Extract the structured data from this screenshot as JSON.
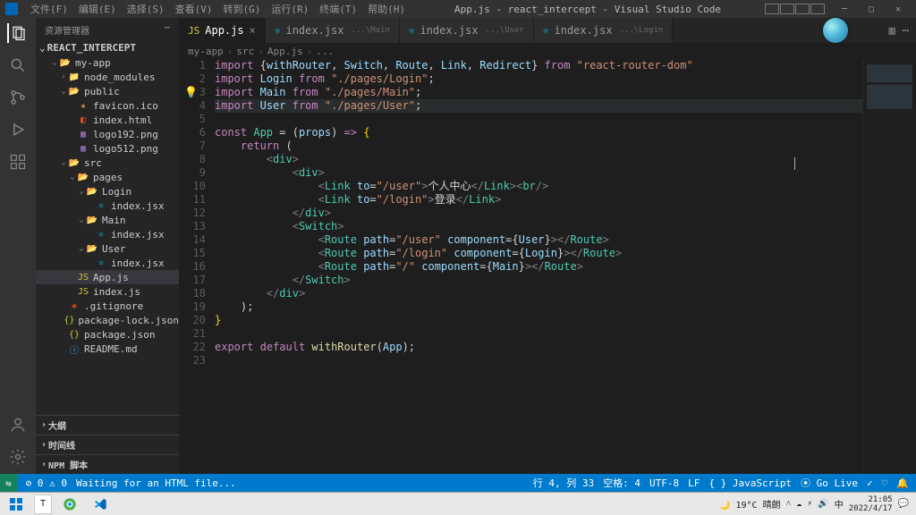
{
  "titlebar": {
    "menus": [
      "文件(F)",
      "编辑(E)",
      "选择(S)",
      "查看(V)",
      "转到(G)",
      "运行(R)",
      "终端(T)",
      "帮助(H)"
    ],
    "title": "App.js - react_intercept - Visual Studio Code"
  },
  "sidebar": {
    "header": "资源管理器",
    "project": "REACT_INTERCEPT",
    "tree": [
      {
        "d": 1,
        "open": true,
        "type": "folder-open",
        "name": "my-app"
      },
      {
        "d": 2,
        "open": false,
        "type": "folder",
        "name": "node_modules",
        "cls": "folder-ico"
      },
      {
        "d": 2,
        "open": true,
        "type": "folder-open",
        "name": "public"
      },
      {
        "d": 3,
        "type": "file",
        "ico": "ico-favicon",
        "name": "favicon.ico"
      },
      {
        "d": 3,
        "type": "file",
        "ico": "ico-html",
        "name": "index.html"
      },
      {
        "d": 3,
        "type": "file",
        "ico": "ico-png",
        "name": "logo192.png"
      },
      {
        "d": 3,
        "type": "file",
        "ico": "ico-png",
        "name": "logo512.png"
      },
      {
        "d": 2,
        "open": true,
        "type": "folder-open",
        "name": "src"
      },
      {
        "d": 3,
        "open": true,
        "type": "folder-open",
        "name": "pages"
      },
      {
        "d": 4,
        "open": true,
        "type": "folder-open",
        "name": "Login"
      },
      {
        "d": 5,
        "type": "file",
        "ico": "ico-react",
        "name": "index.jsx"
      },
      {
        "d": 4,
        "open": true,
        "type": "folder-open",
        "name": "Main"
      },
      {
        "d": 5,
        "type": "file",
        "ico": "ico-react",
        "name": "index.jsx"
      },
      {
        "d": 4,
        "open": true,
        "type": "folder-open",
        "name": "User"
      },
      {
        "d": 5,
        "type": "file",
        "ico": "ico-react",
        "name": "index.jsx"
      },
      {
        "d": 3,
        "type": "file",
        "ico": "ico-js",
        "name": "App.js",
        "sel": true
      },
      {
        "d": 3,
        "type": "file",
        "ico": "ico-js",
        "name": "index.js"
      },
      {
        "d": 2,
        "type": "file",
        "ico": "ico-git",
        "name": ".gitignore"
      },
      {
        "d": 2,
        "type": "file",
        "ico": "ico-json",
        "name": "package-lock.json"
      },
      {
        "d": 2,
        "type": "file",
        "ico": "ico-json",
        "name": "package.json"
      },
      {
        "d": 2,
        "type": "file",
        "ico": "ico-md",
        "name": "README.md"
      }
    ],
    "bottom": [
      "大纲",
      "时间线",
      "NPM 脚本"
    ]
  },
  "tabs": [
    {
      "ico": "ico-js",
      "label": "App.js",
      "active": true,
      "close": true
    },
    {
      "ico": "ico-react",
      "label": "index.jsx",
      "sub": "...\\Main"
    },
    {
      "ico": "ico-react",
      "label": "index.jsx",
      "sub": "...\\User"
    },
    {
      "ico": "ico-react",
      "label": "index.jsx",
      "sub": "...\\Login"
    }
  ],
  "breadcrumb": [
    "my-app",
    "src",
    "App.js",
    "..."
  ],
  "code": {
    "lines": [
      [
        [
          "k",
          "import"
        ],
        [
          "p",
          " {"
        ],
        [
          "v",
          "withRouter"
        ],
        [
          "p",
          ", "
        ],
        [
          "v",
          "Switch"
        ],
        [
          "p",
          ", "
        ],
        [
          "v",
          "Route"
        ],
        [
          "p",
          ", "
        ],
        [
          "v",
          "Link"
        ],
        [
          "p",
          ", "
        ],
        [
          "v",
          "Redirect"
        ],
        [
          "p",
          "} "
        ],
        [
          "k",
          "from"
        ],
        [
          "p",
          " "
        ],
        [
          "s",
          "\"react-router-dom\""
        ]
      ],
      [
        [
          "k",
          "import"
        ],
        [
          "p",
          " "
        ],
        [
          "v",
          "Login"
        ],
        [
          "p",
          " "
        ],
        [
          "k",
          "from"
        ],
        [
          "p",
          " "
        ],
        [
          "s",
          "\"./pages/Login\""
        ],
        [
          "p",
          ";"
        ]
      ],
      [
        [
          "k",
          "import"
        ],
        [
          "p",
          " "
        ],
        [
          "v",
          "Main"
        ],
        [
          "p",
          " "
        ],
        [
          "k",
          "from"
        ],
        [
          "p",
          " "
        ],
        [
          "s",
          "\"./pages/Main\""
        ],
        [
          "p",
          ";"
        ]
      ],
      [
        [
          "k",
          "import"
        ],
        [
          "p",
          " "
        ],
        [
          "v",
          "User"
        ],
        [
          "p",
          " "
        ],
        [
          "k",
          "from"
        ],
        [
          "p",
          " "
        ],
        [
          "s",
          "\"./pages/User\""
        ],
        [
          "p",
          ";"
        ]
      ],
      [],
      [
        [
          "k",
          "const"
        ],
        [
          "p",
          " "
        ],
        [
          "c",
          "App"
        ],
        [
          "p",
          " = ("
        ],
        [
          "v",
          "props"
        ],
        [
          "p",
          ") "
        ],
        [
          "k",
          "=>"
        ],
        [
          "p",
          " "
        ],
        [
          "br",
          "{"
        ]
      ],
      [
        [
          "p",
          "    "
        ],
        [
          "k",
          "return"
        ],
        [
          "p",
          " ("
        ]
      ],
      [
        [
          "p",
          "        "
        ],
        [
          "t",
          "<"
        ],
        [
          "tg",
          "div"
        ],
        [
          "t",
          ">"
        ]
      ],
      [
        [
          "p",
          "            "
        ],
        [
          "t",
          "<"
        ],
        [
          "tg",
          "div"
        ],
        [
          "t",
          ">"
        ]
      ],
      [
        [
          "p",
          "                "
        ],
        [
          "t",
          "<"
        ],
        [
          "tg",
          "Link"
        ],
        [
          "p",
          " "
        ],
        [
          "a",
          "to"
        ],
        [
          "p",
          "="
        ],
        [
          "s",
          "\"/user\""
        ],
        [
          "t",
          ">"
        ],
        [
          "p",
          "个人中心"
        ],
        [
          "t",
          "</"
        ],
        [
          "tg",
          "Link"
        ],
        [
          "t",
          ">"
        ],
        [
          "t",
          "<"
        ],
        [
          "tg",
          "br"
        ],
        [
          "t",
          "/>"
        ]
      ],
      [
        [
          "p",
          "                "
        ],
        [
          "t",
          "<"
        ],
        [
          "tg",
          "Link"
        ],
        [
          "p",
          " "
        ],
        [
          "a",
          "to"
        ],
        [
          "p",
          "="
        ],
        [
          "s",
          "\"/login\""
        ],
        [
          "t",
          ">"
        ],
        [
          "p",
          "登录"
        ],
        [
          "t",
          "</"
        ],
        [
          "tg",
          "Link"
        ],
        [
          "t",
          ">"
        ]
      ],
      [
        [
          "p",
          "            "
        ],
        [
          "t",
          "</"
        ],
        [
          "tg",
          "div"
        ],
        [
          "t",
          ">"
        ]
      ],
      [
        [
          "p",
          "            "
        ],
        [
          "t",
          "<"
        ],
        [
          "tg",
          "Switch"
        ],
        [
          "t",
          ">"
        ]
      ],
      [
        [
          "p",
          "                "
        ],
        [
          "t",
          "<"
        ],
        [
          "tg",
          "Route"
        ],
        [
          "p",
          " "
        ],
        [
          "a",
          "path"
        ],
        [
          "p",
          "="
        ],
        [
          "s",
          "\"/user\""
        ],
        [
          "p",
          " "
        ],
        [
          "a",
          "component"
        ],
        [
          "p",
          "={"
        ],
        [
          "v",
          "User"
        ],
        [
          "p",
          "}"
        ],
        [
          "t",
          "></"
        ],
        [
          "tg",
          "Route"
        ],
        [
          "t",
          ">"
        ]
      ],
      [
        [
          "p",
          "                "
        ],
        [
          "t",
          "<"
        ],
        [
          "tg",
          "Route"
        ],
        [
          "p",
          " "
        ],
        [
          "a",
          "path"
        ],
        [
          "p",
          "="
        ],
        [
          "s",
          "\"/login\""
        ],
        [
          "p",
          " "
        ],
        [
          "a",
          "component"
        ],
        [
          "p",
          "={"
        ],
        [
          "v",
          "Login"
        ],
        [
          "p",
          "}"
        ],
        [
          "t",
          "></"
        ],
        [
          "tg",
          "Route"
        ],
        [
          "t",
          ">"
        ]
      ],
      [
        [
          "p",
          "                "
        ],
        [
          "t",
          "<"
        ],
        [
          "tg",
          "Route"
        ],
        [
          "p",
          " "
        ],
        [
          "a",
          "path"
        ],
        [
          "p",
          "="
        ],
        [
          "s",
          "\"/\""
        ],
        [
          "p",
          " "
        ],
        [
          "a",
          "component"
        ],
        [
          "p",
          "={"
        ],
        [
          "v",
          "Main"
        ],
        [
          "p",
          "}"
        ],
        [
          "t",
          "></"
        ],
        [
          "tg",
          "Route"
        ],
        [
          "t",
          ">"
        ]
      ],
      [
        [
          "p",
          "            "
        ],
        [
          "t",
          "</"
        ],
        [
          "tg",
          "Switch"
        ],
        [
          "t",
          ">"
        ]
      ],
      [
        [
          "p",
          "        "
        ],
        [
          "t",
          "</"
        ],
        [
          "tg",
          "div"
        ],
        [
          "t",
          ">"
        ]
      ],
      [
        [
          "p",
          "    );"
        ]
      ],
      [
        [
          "br",
          "}"
        ]
      ],
      [],
      [
        [
          "k",
          "export"
        ],
        [
          "p",
          " "
        ],
        [
          "k",
          "default"
        ],
        [
          "p",
          " "
        ],
        [
          "f",
          "withRouter"
        ],
        [
          "p",
          "("
        ],
        [
          "v",
          "App"
        ],
        [
          "p",
          ");"
        ]
      ],
      []
    ],
    "highlight_line": 4,
    "bulb_line": 3
  },
  "statusbar": {
    "left_errors": "⊘ 0 ⚠ 0",
    "waiting": "Waiting for an HTML file...",
    "right": [
      "行 4, 列 33",
      "空格: 4",
      "UTF-8",
      "LF",
      "{ } JavaScript",
      "⦿ Go Live",
      "✓",
      "♡",
      "🔔"
    ]
  },
  "taskbar": {
    "weather": "19°C 晴朗",
    "time": "21:05",
    "date": "2022/4/17"
  }
}
